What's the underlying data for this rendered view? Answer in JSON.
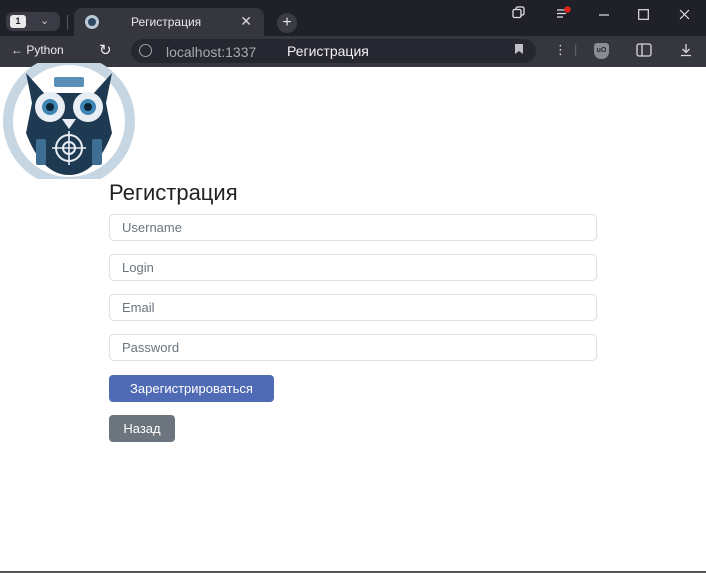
{
  "browser": {
    "tab_count": "1",
    "tab_title": "Регистрация",
    "back_label": "Python",
    "url": "localhost:1337",
    "page_title": "Регистрация",
    "ublock_label": "uO"
  },
  "page": {
    "heading": "Регистрация",
    "fields": {
      "username_placeholder": "Username",
      "login_placeholder": "Login",
      "email_placeholder": "Email",
      "password_placeholder": "Password"
    },
    "register_button": "Зарегистрироваться",
    "back_button": "Назад"
  },
  "colors": {
    "primary": "#4f6bb5",
    "secondary": "#6c757d",
    "chrome_dark": "#1f2028",
    "chrome_bar": "#35363e"
  },
  "icons": [
    "chevron-down-icon",
    "close-icon",
    "plus-icon",
    "copy-icon",
    "reading-list-icon",
    "minimize-icon",
    "maximize-icon",
    "window-close-icon",
    "back-arrow-icon",
    "reload-icon",
    "globe-icon",
    "bookmark-icon",
    "menu-icon",
    "ublock-icon",
    "sidebar-icon",
    "download-icon",
    "owl-logo"
  ]
}
